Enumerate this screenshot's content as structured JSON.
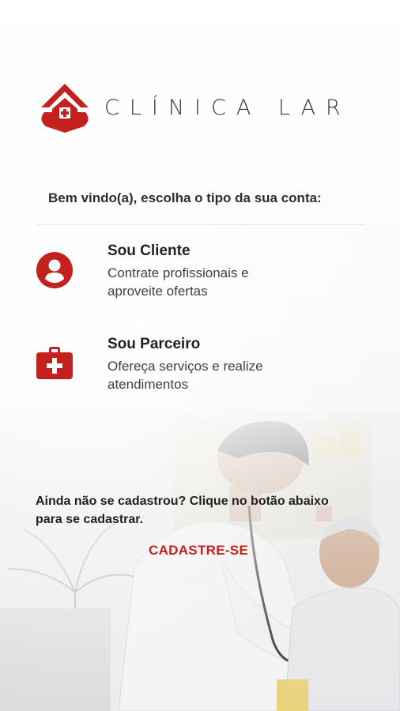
{
  "brand": {
    "name": "CLÍNICA LAR",
    "accent": "#c4201d"
  },
  "welcome": "Bem vindo(a), escolha o tipo da sua conta:",
  "options": [
    {
      "title": "Sou Cliente",
      "description": "Contrate profissionais e aproveite ofertas",
      "icon": "user-circle-icon"
    },
    {
      "title": "Sou Parceiro",
      "description": "Ofereça serviços e realize atendimentos",
      "icon": "medical-kit-icon"
    }
  ],
  "signup": {
    "prompt": "Ainda não se cadastrou? Clique no botão abaixo para se cadastrar.",
    "button_label": "CADASTRE-SE"
  }
}
